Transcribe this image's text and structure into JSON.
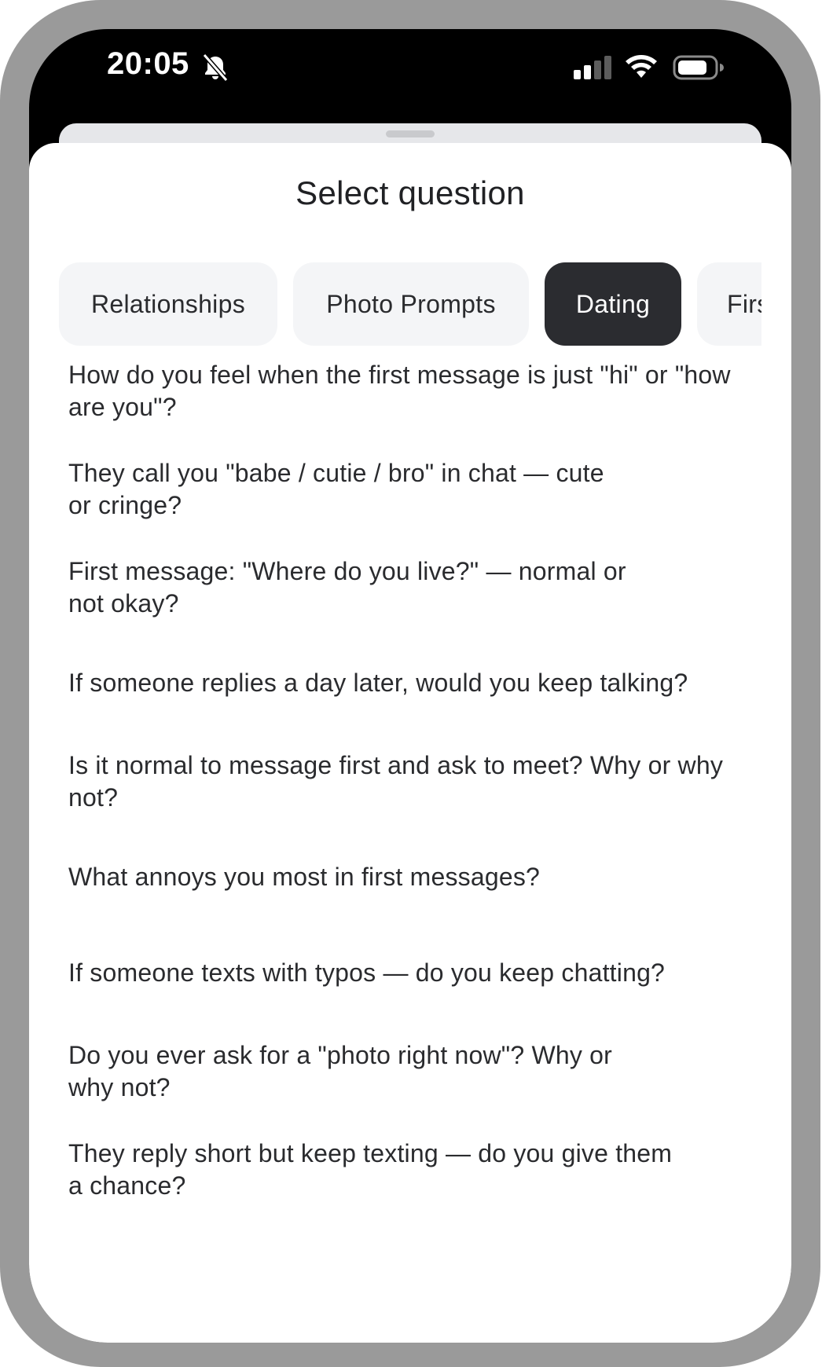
{
  "status_bar": {
    "time": "20:05",
    "icons": [
      "bell-slash-icon",
      "signal-icon",
      "wifi-icon",
      "battery-icon"
    ]
  },
  "sheet": {
    "title": "Select question"
  },
  "tabs": [
    {
      "label": "Relationships",
      "active": false
    },
    {
      "label": "Photo Prompts",
      "active": false
    },
    {
      "label": "Dating",
      "active": true
    },
    {
      "label": "First",
      "active": false
    }
  ],
  "questions": [
    "How do you feel when the first message is just \"hi\" or \"how are you\"?",
    "They call you \"babe / cutie / bro\" in chat — cute or cringe?",
    "First message: \"Where do you live?\" — normal or not okay?",
    "If someone replies a day later, would you keep talking?",
    "Is it normal to message first and ask to meet? Why or why not?",
    "What annoys you most in first messages?",
    "If someone texts with typos — do you keep chatting?",
    "Do you ever ask for a \"photo right now\"? Why or why not?",
    "They reply short but keep texting — do you give them a chance?"
  ],
  "colors": {
    "frame": "#9a9a9a",
    "active_tab": "#2b2c30",
    "inactive_tab": "#f4f5f7",
    "text": "#2a2b2e"
  }
}
